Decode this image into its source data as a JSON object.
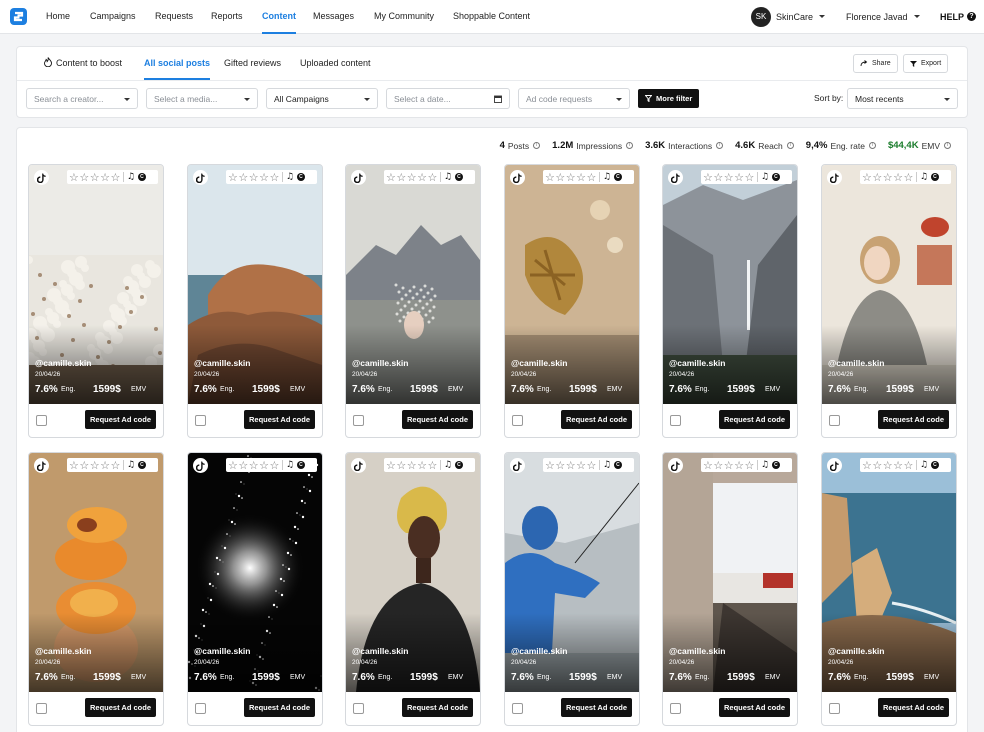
{
  "nav": {
    "items": [
      "Home",
      "Campaigns",
      "Requests",
      "Reports",
      "Content",
      "Messages",
      "My Community",
      "Shoppable Content"
    ],
    "brand_initials": "SK",
    "brand_name": "SkinCare",
    "user_name": "Florence Javad",
    "help_label": "HELP",
    "help_icon": "?"
  },
  "tabs": [
    "Content to boost",
    "All social posts",
    "Gifted reviews",
    "Uploaded content"
  ],
  "actions": {
    "share": "Share",
    "export": "Export"
  },
  "filters": {
    "creator_placeholder": "Search a creator...",
    "media_placeholder": "Select a media...",
    "campaign_value": "All Campaigns",
    "date_placeholder": "Select a date...",
    "ad_code_placeholder": "Ad code requests",
    "more_filter": "More filter",
    "sort_label": "Sort by:",
    "sort_value": "Most recents"
  },
  "stats": [
    {
      "value": "4",
      "label": "Posts"
    },
    {
      "value": "1.2M",
      "label": "Impressions"
    },
    {
      "value": "3.6K",
      "label": "Interactions"
    },
    {
      "value": "4.6K",
      "label": "Reach"
    },
    {
      "value": "9,4%",
      "label": "Eng. rate"
    },
    {
      "value": "$44,4K",
      "label": "EMV"
    }
  ],
  "card_common": {
    "stars": [
      "☆",
      "☆",
      "☆",
      "☆",
      "☆"
    ],
    "music_glyph": "♫",
    "copyright_glyph": "C",
    "eng_label": "Eng.",
    "emv_label": "EMV",
    "request_button": "Request Ad code"
  },
  "posts": [
    {
      "handle": "@camille.skin",
      "date": "20/04/26",
      "eng": "7.6%",
      "emv": "1599$",
      "image": "white-flowers"
    },
    {
      "handle": "@camille.skin",
      "date": "20/04/26",
      "eng": "7.6%",
      "emv": "1599$",
      "image": "coastal-rocks"
    },
    {
      "handle": "@camille.skin",
      "date": "20/04/26",
      "eng": "7.6%",
      "emv": "1599$",
      "image": "mountain-lake-splash"
    },
    {
      "handle": "@camille.skin",
      "date": "20/04/26",
      "eng": "7.6%",
      "emv": "1599$",
      "image": "sand-seaweed"
    },
    {
      "handle": "@camille.skin",
      "date": "20/04/26",
      "eng": "7.6%",
      "emv": "1599$",
      "image": "valley-waterfall"
    },
    {
      "handle": "@camille.skin",
      "date": "20/04/26",
      "eng": "7.6%",
      "emv": "1599$",
      "image": "woman-on-phone"
    },
    {
      "handle": "@camille.skin",
      "date": "20/04/26",
      "eng": "7.6%",
      "emv": "1599$",
      "image": "stacked-peaches"
    },
    {
      "handle": "@camille.skin",
      "date": "20/04/26",
      "eng": "7.6%",
      "emv": "1599$",
      "image": "star-cluster"
    },
    {
      "handle": "@camille.skin",
      "date": "20/04/26",
      "eng": "7.6%",
      "emv": "1599$",
      "image": "blonde-woman-portrait"
    },
    {
      "handle": "@camille.skin",
      "date": "20/04/26",
      "eng": "7.6%",
      "emv": "1599$",
      "image": "fisherman-blue-jacket"
    },
    {
      "handle": "@camille.skin",
      "date": "20/04/26",
      "eng": "7.6%",
      "emv": "1599$",
      "image": "concrete-terrace"
    },
    {
      "handle": "@camille.skin",
      "date": "20/04/26",
      "eng": "7.6%",
      "emv": "1599$",
      "image": "sea-cliffs"
    }
  ],
  "colors": {
    "accent": "#1d7fe0",
    "emv_green": "#1b7d2c",
    "dark_button": "#111111"
  }
}
